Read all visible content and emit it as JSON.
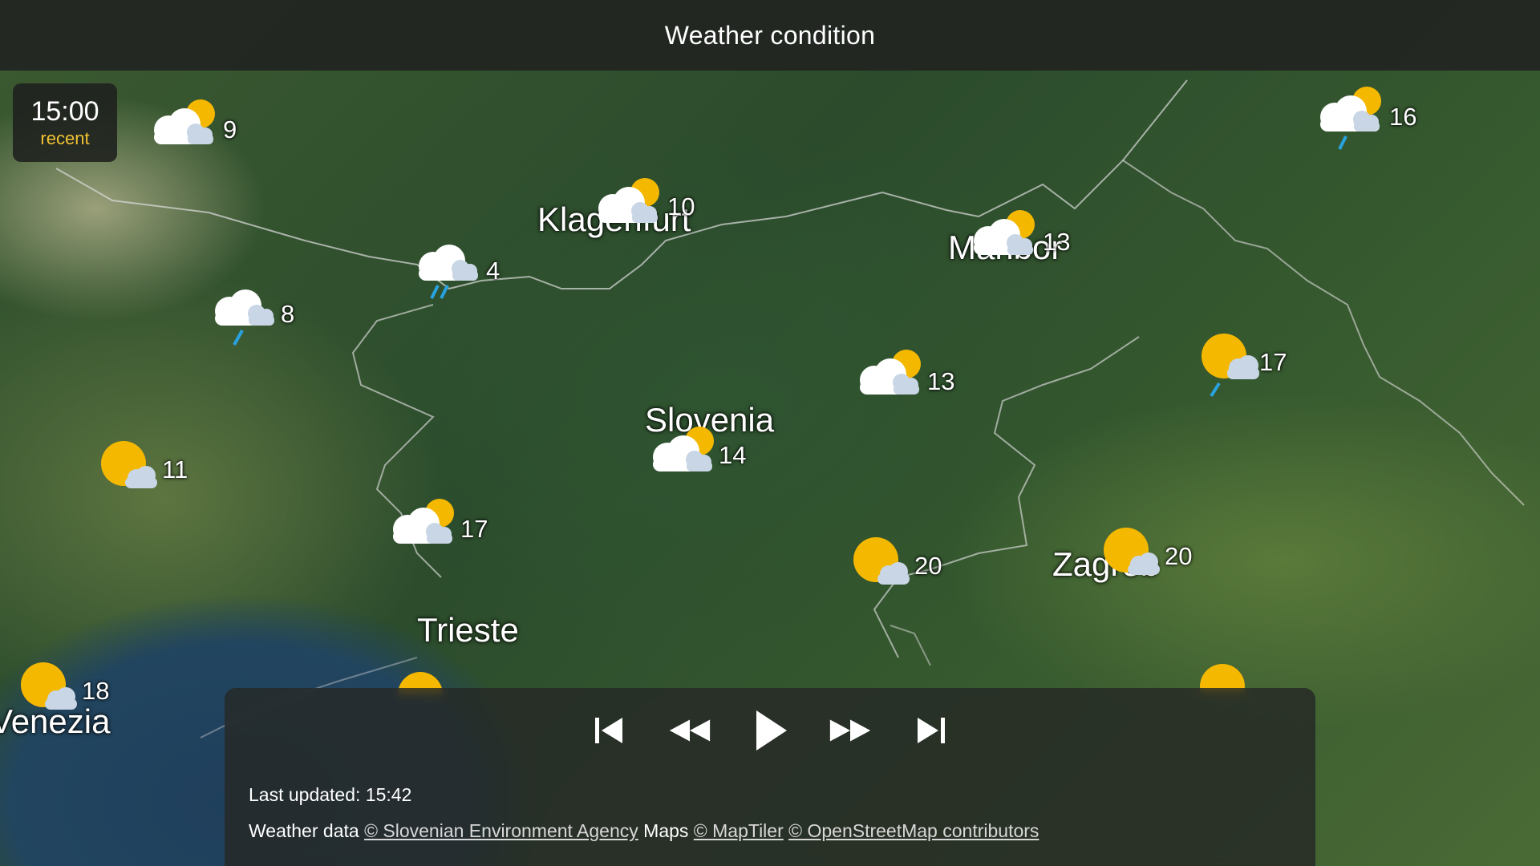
{
  "header": {
    "title": "Weather condition"
  },
  "time": {
    "value": "15:00",
    "status": "recent"
  },
  "cities": [
    {
      "id": "klagenfurt",
      "name": "Klagenfurt"
    },
    {
      "id": "maribor",
      "name": "Maribor"
    },
    {
      "id": "slovenia",
      "name": "Slovenia"
    },
    {
      "id": "zagreb",
      "name": "Zagreb"
    },
    {
      "id": "trieste",
      "name": "Trieste"
    },
    {
      "id": "venezia",
      "name": "Venezia"
    }
  ],
  "stations": [
    {
      "id": "s1",
      "icon": "partly-cloudy-icon",
      "temp": "9"
    },
    {
      "id": "s2",
      "icon": "partly-cloudy-icon",
      "temp": "10"
    },
    {
      "id": "s3",
      "icon": "cloudy-rain-icon",
      "temp": "4"
    },
    {
      "id": "s4",
      "icon": "cloudy-light-rain-icon",
      "temp": "8"
    },
    {
      "id": "s5",
      "icon": "partly-cloudy-icon",
      "temp": "13"
    },
    {
      "id": "s6",
      "icon": "partly-cloudy-light-rain-icon",
      "temp": "16"
    },
    {
      "id": "s7",
      "icon": "partly-cloudy-icon",
      "temp": "13"
    },
    {
      "id": "s8",
      "icon": "mostly-sunny-light-rain-icon",
      "temp": "17"
    },
    {
      "id": "s9",
      "icon": "mostly-sunny-icon",
      "temp": "11"
    },
    {
      "id": "s10",
      "icon": "partly-cloudy-icon",
      "temp": "14"
    },
    {
      "id": "s11",
      "icon": "partly-cloudy-icon",
      "temp": "17"
    },
    {
      "id": "s12",
      "icon": "mostly-sunny-icon",
      "temp": "20"
    },
    {
      "id": "s13",
      "icon": "mostly-sunny-icon",
      "temp": "20"
    },
    {
      "id": "s14",
      "icon": "mostly-sunny-icon",
      "temp": "18"
    }
  ],
  "player": {
    "controls": [
      "skip-to-start-icon",
      "rewind-icon",
      "play-icon",
      "fast-forward-icon",
      "skip-to-end-icon"
    ],
    "last_updated": "Last updated: 15:42",
    "credits": {
      "weather_label": "Weather data",
      "weather_link": "© Slovenian Environment Agency",
      "maps_label": "Maps",
      "maptiler_link": "© MapTiler",
      "osm_link": "© OpenStreetMap contributors"
    }
  },
  "colors": {
    "sun": "#f5b800",
    "rain": "#29a3e0",
    "accent": "#f1c232"
  }
}
